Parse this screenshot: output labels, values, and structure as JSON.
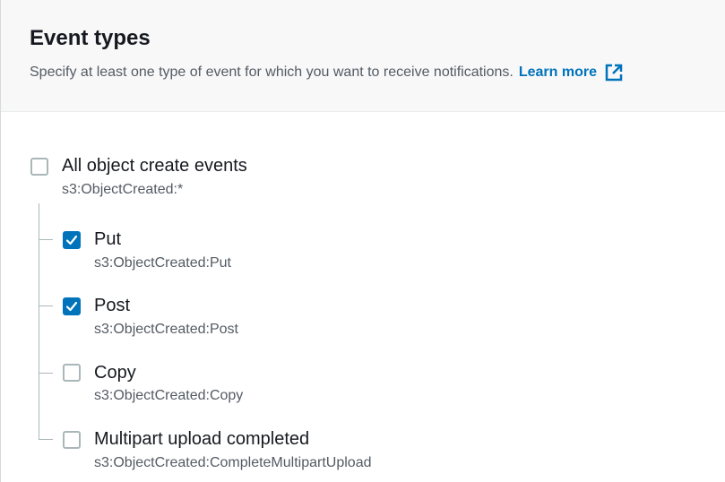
{
  "section": {
    "title": "Event types",
    "description": "Specify at least one type of event for which you want to receive notifications.",
    "learn_more": "Learn more",
    "link_icon": "external-link-icon"
  },
  "parent_event": {
    "label": "All object create events",
    "code": "s3:ObjectCreated:*",
    "checked": false
  },
  "events": [
    {
      "label": "Put",
      "code": "s3:ObjectCreated:Put",
      "checked": true
    },
    {
      "label": "Post",
      "code": "s3:ObjectCreated:Post",
      "checked": true
    },
    {
      "label": "Copy",
      "code": "s3:ObjectCreated:Copy",
      "checked": false
    },
    {
      "label": "Multipart upload completed",
      "code": "s3:ObjectCreated:CompleteMultipartUpload",
      "checked": false
    }
  ],
  "colors": {
    "accent": "#0073bb",
    "text": "#16191f",
    "muted": "#545b64",
    "border": "#aab7b8",
    "header_bg": "#f8f8f9"
  }
}
